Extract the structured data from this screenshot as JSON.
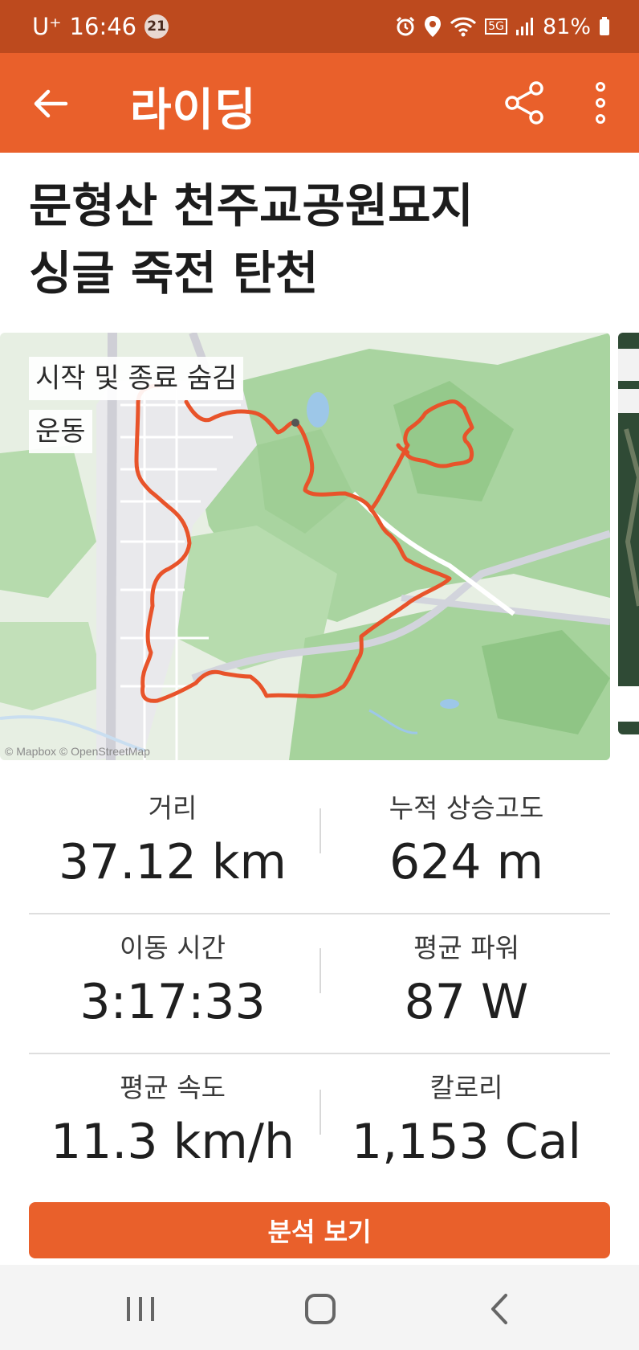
{
  "status": {
    "carrier": "U⁺",
    "time": "16:46",
    "notification_count": "21",
    "network": "5G",
    "battery": "81%"
  },
  "app_bar": {
    "title": "라이딩",
    "icons": [
      "back-arrow-icon",
      "share-icon",
      "more-vert-icon"
    ]
  },
  "activity": {
    "title_line1": "문형산 천주교공원묘지",
    "title_line2": "싱글 죽전 탄천"
  },
  "map": {
    "hide_start_end_label": "시작 및 종료 숨김",
    "type_tag": "운동",
    "attribution": "© Mapbox © OpenStreetMap",
    "route_color": "#e8532a"
  },
  "stats": [
    {
      "label": "거리",
      "value": "37.12 km"
    },
    {
      "label": "누적 상승고도",
      "value": "624 m"
    },
    {
      "label": "이동 시간",
      "value": "3:17:33"
    },
    {
      "label": "평균 파워",
      "value": "87 W"
    },
    {
      "label": "평균 속도",
      "value": "11.3 km/h"
    },
    {
      "label": "칼로리",
      "value": "1,153 Cal"
    }
  ],
  "analyze_button": "분석 보기",
  "colors": {
    "brand": "#e9602b",
    "status_bar": "#bd4a1e"
  }
}
